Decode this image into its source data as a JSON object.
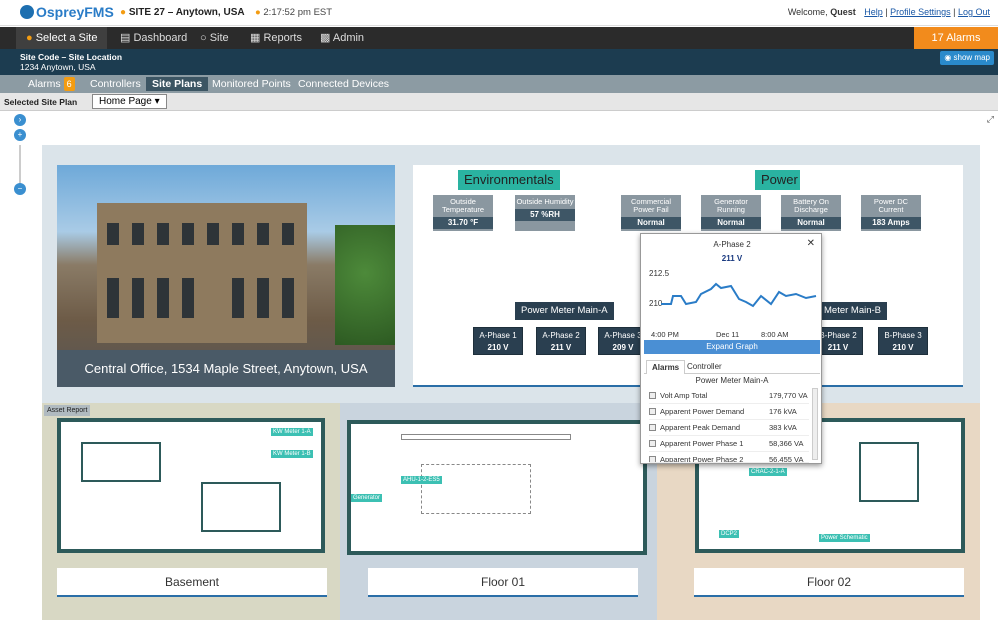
{
  "header": {
    "logo": "OspreyFMS",
    "site": "SITE 27 – Anytown, USA",
    "time": "2:17:52 pm EST",
    "welcome": "Welcome,",
    "user": "Quest",
    "help": "Help",
    "profile": "Profile Settings",
    "logout": "Log Out"
  },
  "nav": {
    "select_site": "Select a Site",
    "dashboard": "Dashboard",
    "site": "Site",
    "reports": "Reports",
    "admin": "Admin",
    "alarms": "17 Alarms"
  },
  "siteinfo": {
    "line1": "Site Code – Site Location",
    "line2": "1234 Anytown, USA",
    "show_map": "show map"
  },
  "tabs": {
    "alarms": "Alarms",
    "alarms_count": "6",
    "controllers": "Controllers",
    "site_plans": "Site Plans",
    "monitored": "Monitored Points",
    "connected": "Connected Devices"
  },
  "plan": {
    "label": "Selected Site Plan",
    "value": "Home Page ▾"
  },
  "photo": {
    "caption": "Central Office, 1534 Maple Street, Anytown, USA"
  },
  "env": {
    "title": "Environmentals",
    "t1_label": "Outside Temperature",
    "t1_val": "31.70 °F",
    "t2_label": "Outside Humidity",
    "t2_val": "57 %RH"
  },
  "power": {
    "title": "Power",
    "p1_label": "Commercial Power Fail",
    "p1_val": "Normal",
    "p2_label": "Generator Running",
    "p2_val": "Normal",
    "p3_label": "Battery On Discharge",
    "p3_val": "Normal",
    "p4_label": "Power DC Current",
    "p4_val": "183 Amps"
  },
  "pm_a": {
    "title": "Power Meter Main-A",
    "ph1": "A-Phase 1",
    "v1": "210 V",
    "ph2": "A-Phase 2",
    "v2": "211 V",
    "ph3": "A-Phase 3",
    "v3": "209 V"
  },
  "pm_b": {
    "title": "Meter Main-B",
    "ph2": "B-Phase 2",
    "v2": "211 V",
    "ph3": "B-Phase 3",
    "v3": "210 V"
  },
  "popup": {
    "title": "A-Phase 2",
    "value": "211 V",
    "y_hi": "212.5",
    "y_lo": "210",
    "x1": "4:00 PM",
    "x2": "Dec 11",
    "x3": "8:00 AM",
    "expand": "Expand Graph",
    "tab1": "Alarms",
    "tab2": "Controller",
    "subtitle": "Power Meter Main-A",
    "rows": [
      {
        "n": "Volt Amp Total",
        "v": "179,770 VA"
      },
      {
        "n": "Apparent Power Demand",
        "v": "176 kVA"
      },
      {
        "n": "Apparent Peak Demand",
        "v": "383 kVA"
      },
      {
        "n": "Apparent Power Phase 1",
        "v": "58,366 VA"
      },
      {
        "n": "Apparent Power Phase 2",
        "v": "56,455 VA"
      }
    ]
  },
  "floors": {
    "asset": "Asset Report",
    "b": "Basement",
    "f1": "Floor 01",
    "f2": "Floor 02",
    "kw1": "KW Meter 1-A",
    "kw2": "KW Meter 1-B",
    "ahu": "AHU-1-2-ES5",
    "gen": "Generator",
    "crac": "CRAC-2-1-A",
    "dcp": "DCP2",
    "psch": "Power Schematic"
  },
  "colors": {
    "accent": "#f28b1c",
    "nav": "#2b2b2b",
    "teal": "#2ab3a1",
    "basement_bg": "#d8d8c4",
    "floor1_bg": "#c9d4de",
    "floor2_bg": "#e8d8c4"
  }
}
